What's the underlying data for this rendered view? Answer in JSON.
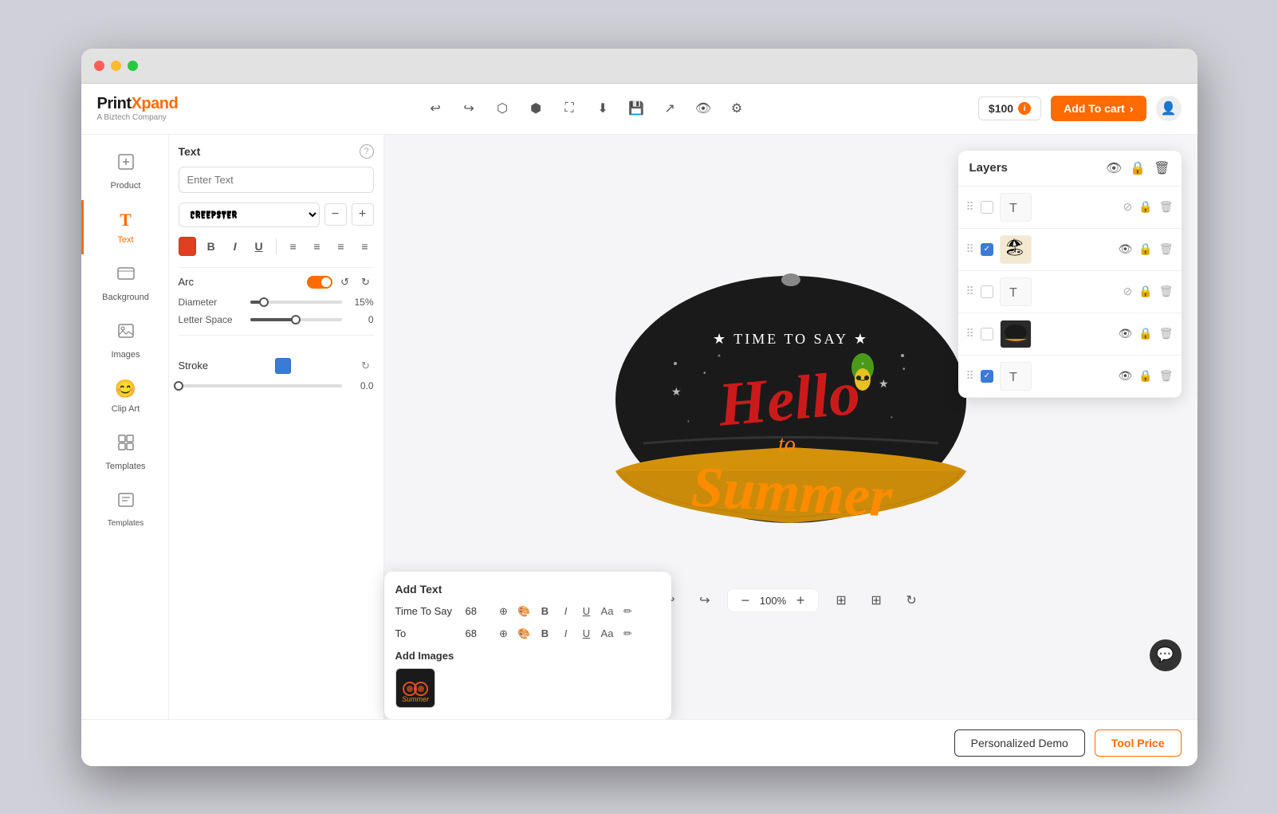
{
  "browser": {
    "traffic_lights": [
      "red",
      "yellow",
      "green"
    ]
  },
  "header": {
    "logo_main": "PrintXpand",
    "logo_bold": "X",
    "logo_sub": "A Biztech Company",
    "price_label": "$100",
    "add_to_cart_label": "Add To cart",
    "tools": [
      "undo",
      "redo",
      "group",
      "ungroup",
      "expand",
      "download",
      "save",
      "share",
      "eye",
      "settings"
    ]
  },
  "sidebar": {
    "items": [
      {
        "id": "product",
        "label": "Product",
        "icon": "📦"
      },
      {
        "id": "text",
        "label": "Text",
        "icon": "T",
        "active": true
      },
      {
        "id": "background",
        "label": "Background",
        "icon": "🖼"
      },
      {
        "id": "images",
        "label": "Images",
        "icon": "🏔"
      },
      {
        "id": "clipart",
        "label": "Clip Art",
        "icon": "😊"
      },
      {
        "id": "templates",
        "label": "Templates",
        "icon": "📄"
      },
      {
        "id": "templates2",
        "label": "Templates",
        "icon": "📋"
      }
    ]
  },
  "tools_panel": {
    "title": "Text",
    "info_tooltip": "?",
    "input_placeholder": "Enter Text",
    "font_name": "CREEPSTER",
    "font_minus": "−",
    "font_plus": "+",
    "format_buttons": [
      "B",
      "I",
      "U",
      "align-left",
      "align-center",
      "align-right",
      "justify"
    ],
    "arc_label": "Arc",
    "arc_toggle": true,
    "diameter_label": "Diameter",
    "diameter_value": "15%",
    "letter_space_label": "Letter Space",
    "letter_space_value": "0",
    "stroke_label": "Stroke",
    "stroke_value": "0.0",
    "stroke_slider_pct": 0
  },
  "canvas": {
    "zoom_percent": "100%",
    "zoom_minus": "−",
    "zoom_plus": "+"
  },
  "layers": {
    "title": "Layers",
    "items": [
      {
        "id": 1,
        "type": "text",
        "checked": false,
        "hidden": true
      },
      {
        "id": 2,
        "type": "image",
        "checked": true,
        "hidden": false,
        "has_thumb": true
      },
      {
        "id": 3,
        "type": "text",
        "checked": false,
        "hidden": true
      },
      {
        "id": 4,
        "type": "hat",
        "checked": false,
        "hidden": false,
        "is_hat": true
      },
      {
        "id": 5,
        "type": "text",
        "checked": true,
        "hidden": false
      }
    ]
  },
  "add_text_popup": {
    "title": "Add Text",
    "items": [
      {
        "label": "Time To Say",
        "size": "68"
      },
      {
        "label": "To",
        "size": "68"
      }
    ],
    "add_images_title": "Add Images"
  },
  "bottom_bar": {
    "personalized_demo_label": "Personalized Demo",
    "tool_price_label": "Tool Price"
  }
}
